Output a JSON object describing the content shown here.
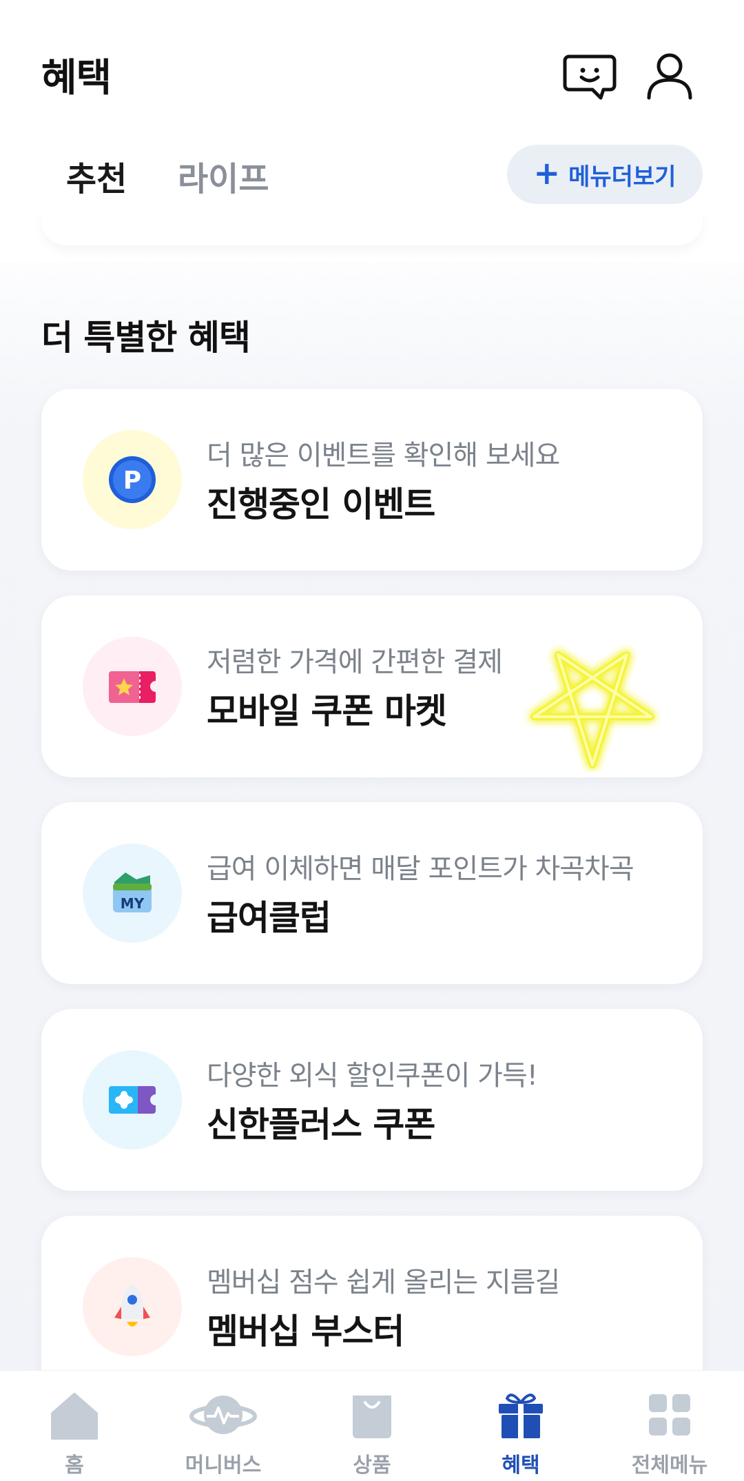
{
  "header": {
    "title": "혜택",
    "chat_icon": "chat-bubble-icon",
    "profile_icon": "profile-icon"
  },
  "tabs": [
    {
      "label": "추천",
      "active": true
    },
    {
      "label": "라이프",
      "active": false
    }
  ],
  "more_menu": {
    "label": "메뉴더보기",
    "icon": "plus-icon"
  },
  "section": {
    "title": "더 특별한 혜택"
  },
  "cards": [
    {
      "subtitle": "더 많은 이벤트를 확인해 보세요",
      "title": "진행중인 이벤트",
      "icon": "point-coin-icon",
      "circle_color": "#fffbd6"
    },
    {
      "subtitle": "저렴한 가격에 간편한 결제",
      "title": "모바일 쿠폰 마켓",
      "icon": "ticket-icon",
      "circle_color": "#ffeef4"
    },
    {
      "subtitle": "급여 이체하면 매달 포인트가 차곡차곡",
      "title": "급여클럽",
      "icon": "my-wallet-icon",
      "circle_color": "#eaf6fd"
    },
    {
      "subtitle": "다양한 외식 할인쿠폰이 가득!",
      "title": "신한플러스 쿠폰",
      "icon": "coupon-icon",
      "circle_color": "#e8f6fd"
    },
    {
      "subtitle": "멤버십 점수 쉽게 올리는 지름길",
      "title": "멤버십 부스터",
      "icon": "rocket-icon",
      "circle_color": "#fff0ee"
    }
  ],
  "bottom_nav": [
    {
      "label": "홈",
      "icon": "home-icon",
      "active": false
    },
    {
      "label": "머니버스",
      "icon": "planet-icon",
      "active": false
    },
    {
      "label": "상품",
      "icon": "shopping-bag-icon",
      "active": false
    },
    {
      "label": "혜택",
      "icon": "gift-icon",
      "active": true
    },
    {
      "label": "전체메뉴",
      "icon": "grid-menu-icon",
      "active": false
    }
  ],
  "colors": {
    "accent": "#1f5fd9",
    "nav_active": "#1f4fb5",
    "nav_inactive": "#9aa1ab",
    "star_glow": "#f4f33a"
  }
}
